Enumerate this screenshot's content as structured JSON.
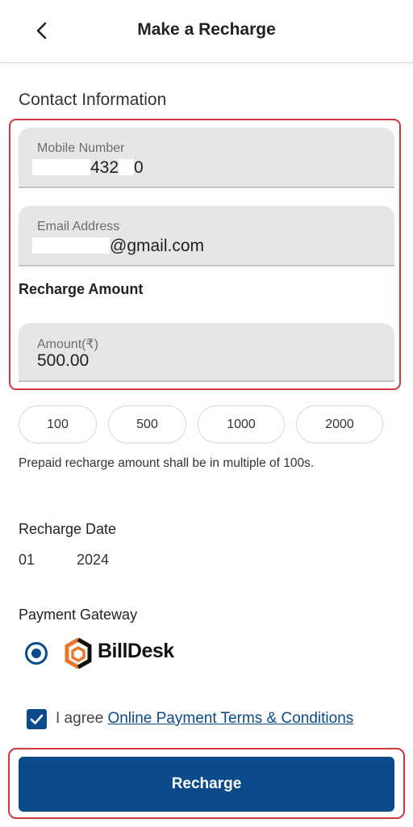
{
  "header": {
    "title": "Make a Recharge",
    "back_icon": "chevron-left-icon"
  },
  "contact": {
    "section_title": "Contact Information",
    "mobile": {
      "label": "Mobile Number",
      "value_visible_part_1": "432",
      "value_visible_part_2": "0"
    },
    "email": {
      "label": "Email Address",
      "value_visible": "@gmail.com"
    }
  },
  "amount": {
    "subhead": "Recharge Amount",
    "label": "Amount(₹)",
    "value": "500.00",
    "chips": [
      "100",
      "500",
      "1000",
      "2000"
    ],
    "hint": "Prepaid recharge amount shall be in multiple of 100s."
  },
  "date": {
    "label": "Recharge Date",
    "day": "01",
    "year": "2024"
  },
  "payment": {
    "label": "Payment Gateway",
    "gateway_name": "BillDesk",
    "selected": true
  },
  "terms": {
    "checked": true,
    "prefix": "I agree ",
    "link_text": "Online Payment Terms & Conditions"
  },
  "actions": {
    "recharge_label": "Recharge"
  },
  "colors": {
    "primary": "#0b4a8b",
    "highlight": "#d0343f",
    "logo_orange": "#e8792b"
  }
}
